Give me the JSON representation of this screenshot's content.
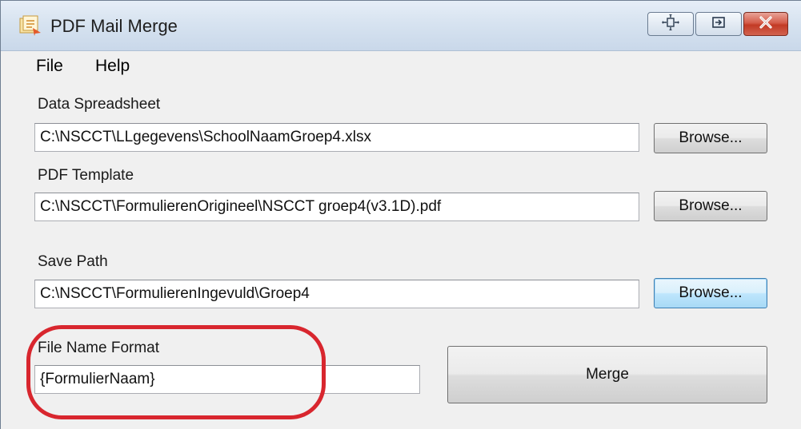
{
  "window": {
    "title": "PDF Mail Merge"
  },
  "menu": {
    "items": [
      {
        "label": "File"
      },
      {
        "label": "Help"
      }
    ]
  },
  "form": {
    "data_spreadsheet": {
      "label": "Data Spreadsheet",
      "value": "C:\\NSCCT\\LLgegevens\\SchoolNaamGroep4.xlsx",
      "browse_label": "Browse..."
    },
    "pdf_template": {
      "label": "PDF Template",
      "value": "C:\\NSCCT\\FormulierenOrigineel\\NSCCT groep4(v3.1D).pdf",
      "browse_label": "Browse..."
    },
    "save_path": {
      "label": "Save Path",
      "value": "C:\\NSCCT\\FormulierenIngevuld\\Groep4",
      "browse_label": "Browse..."
    },
    "file_name_format": {
      "label": "File Name Format",
      "value": "{FormulierNaam}"
    },
    "merge_label": "Merge"
  },
  "colors": {
    "annotation": "#d8262e",
    "close_button": "#c23a25"
  },
  "icons": {
    "app": "pdf-merge-icon",
    "help": "help-context-icon",
    "pin": "pin-icon",
    "close": "close-icon"
  }
}
